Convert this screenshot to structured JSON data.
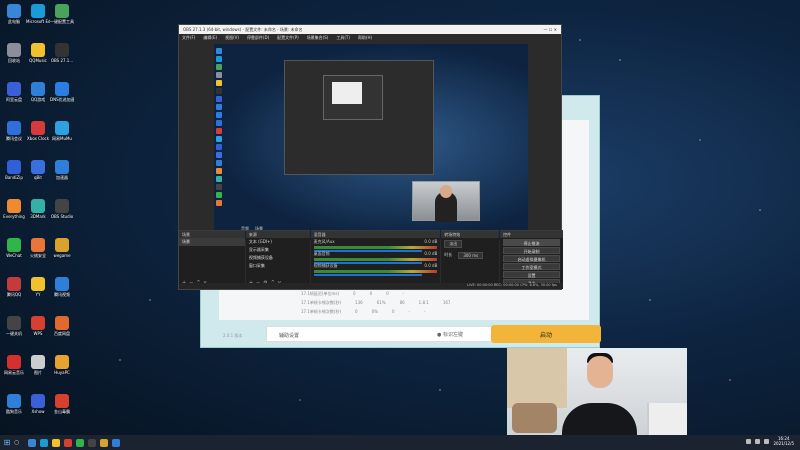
{
  "desktop": {
    "icons": [
      {
        "label": "此电脑",
        "color": "#3a86d6"
      },
      {
        "label": "Microsoft Edge",
        "color": "#1a9ad6"
      },
      {
        "label": "一键配置工具",
        "color": "#4aa35a"
      },
      {
        "label": "回收站",
        "color": "#8a8f99"
      },
      {
        "label": "QQMusic",
        "color": "#f2c12e"
      },
      {
        "label": "OBS 27.1...",
        "color": "#333333"
      },
      {
        "label": "阿里云盘",
        "color": "#3a5fd6"
      },
      {
        "label": "QQ游戏",
        "color": "#2f7fd9"
      },
      {
        "label": "DNS优选加速",
        "color": "#2a7de1"
      },
      {
        "label": "腾讯会议",
        "color": "#2f6fd9"
      },
      {
        "label": "Xbox Clock",
        "color": "#d63a3a"
      },
      {
        "label": "网易MuMu",
        "color": "#2fa0e0"
      },
      {
        "label": "BandiZip",
        "color": "#2f5fd9"
      },
      {
        "label": "qBit",
        "color": "#3a6fe0"
      },
      {
        "label": "加速器",
        "color": "#2f7fd9"
      },
      {
        "label": "Everything",
        "color": "#f08a2e"
      },
      {
        "label": "3DMark",
        "color": "#35b0a6"
      },
      {
        "label": "OBS Studio",
        "color": "#444444"
      },
      {
        "label": "WeChat",
        "color": "#2fb54a"
      },
      {
        "label": "火绒安全",
        "color": "#e8753a"
      },
      {
        "label": "wegame",
        "color": "#d9a22e"
      },
      {
        "label": "腾讯QQ",
        "color": "#c53a3a"
      },
      {
        "label": "YY",
        "color": "#f2c12e"
      },
      {
        "label": "腾讯视频",
        "color": "#2f7fd9"
      },
      {
        "label": "一键关机",
        "color": "#444444"
      },
      {
        "label": "WPS",
        "color": "#d6402e"
      },
      {
        "label": "百度网盘",
        "color": "#e06a2e"
      },
      {
        "label": "网易云音乐",
        "color": "#d6302e"
      },
      {
        "label": "图片",
        "color": "#cccccc"
      },
      {
        "label": "HuyaPC",
        "color": "#e8a32e"
      },
      {
        "label": "酷狗音乐",
        "color": "#2f7fd9"
      },
      {
        "label": "Xshow",
        "color": "#3a5fd6"
      },
      {
        "label": "金山毒霸",
        "color": "#d6402e"
      }
    ]
  },
  "obs": {
    "title": "OBS 27.1.3 (64-bit, windows) - 配置文件: 未命名 - 场景: 未命名",
    "menu": [
      "文件(F)",
      "编辑(E)",
      "视图(V)",
      "停靠部件(D)",
      "配置文件(P)",
      "场景集合(S)",
      "工具(T)",
      "帮助(H)"
    ],
    "panel_tabs": [
      "音频",
      "场景"
    ],
    "docks": {
      "scenes_header": "场景",
      "scenes": [
        "场景"
      ],
      "sources_header": "来源",
      "sources": [
        "文本 (GDI+)",
        "显示器采集",
        "视频捕获设备",
        "窗口采集"
      ],
      "mixer_header": "混音器",
      "mixer": [
        {
          "name": "麦克风/Aux",
          "db": "0.0 dB"
        },
        {
          "name": "桌面音频",
          "db": "0.0 dB"
        },
        {
          "name": "视频捕获设备",
          "db": "0.0 dB"
        }
      ],
      "transitions_header": "转场特效",
      "transition_type": "淡出",
      "duration_label": "时长",
      "duration_value": "300 ms",
      "controls_header": "控件",
      "controls": [
        "停止推流",
        "开始录制",
        "启动虚拟摄像机",
        "工作室模式",
        "设置",
        "退出"
      ]
    },
    "status": "LIVE: 00:00:00   REC: 00:00:00   CPU: 6.8%, 30.00 fps"
  },
  "background_app": {
    "rows": [
      [
        "17.1帧延迟(单位ms)",
        "0",
        "0",
        "0",
        "-"
      ],
      [
        "17.1单帧卡顿次数(秒)",
        "136",
        "61%",
        "86",
        "1.8.1",
        "167"
      ],
      [
        "17.1单帧卡顿次数(秒)",
        "0",
        "0%",
        "0",
        "-",
        "-"
      ]
    ],
    "footer_label": "辅助设置",
    "hint": "● 标识左键",
    "version": "2.0.1 版本",
    "start_button": "启动"
  },
  "taskbar": {
    "time": "16:24",
    "date": "2021/12/5"
  }
}
